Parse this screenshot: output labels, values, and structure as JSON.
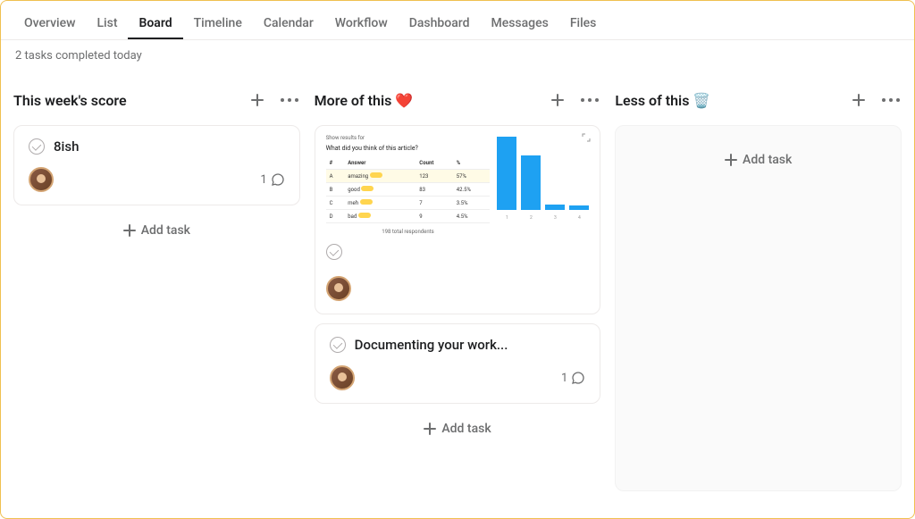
{
  "tabs": [
    "Overview",
    "List",
    "Board",
    "Timeline",
    "Calendar",
    "Workflow",
    "Dashboard",
    "Messages",
    "Files"
  ],
  "active_tab": "Board",
  "status": "2 tasks completed today",
  "add_task_label": "Add task",
  "columns": [
    {
      "title": "This week's score"
    },
    {
      "title": "More of this ❤️"
    },
    {
      "title": "Less of this 🗑️"
    }
  ],
  "col0_card0": {
    "title": "8ish",
    "comments": "1"
  },
  "col1_card1": {
    "title": "Documenting your work...",
    "comments": "1"
  },
  "chart_data": {
    "type": "bar",
    "header": "Show results for",
    "question": "What did you think of this article?",
    "table_headers": [
      "#",
      "Answer",
      "Count",
      "%"
    ],
    "rows": [
      {
        "idx": "A",
        "answer": "amazing",
        "count": "123",
        "pct": "57%"
      },
      {
        "idx": "B",
        "answer": "good",
        "count": "83",
        "pct": "42.5%"
      },
      {
        "idx": "C",
        "answer": "meh",
        "count": "7",
        "pct": "3.5%"
      },
      {
        "idx": "D",
        "answer": "bad",
        "count": "9",
        "pct": "4.5%"
      }
    ],
    "total_label": "198 total respondents",
    "categories": [
      "1",
      "2",
      "3",
      "4"
    ],
    "values": [
      57,
      42.5,
      4.5,
      3.5
    ],
    "ylim": [
      0,
      60
    ]
  }
}
